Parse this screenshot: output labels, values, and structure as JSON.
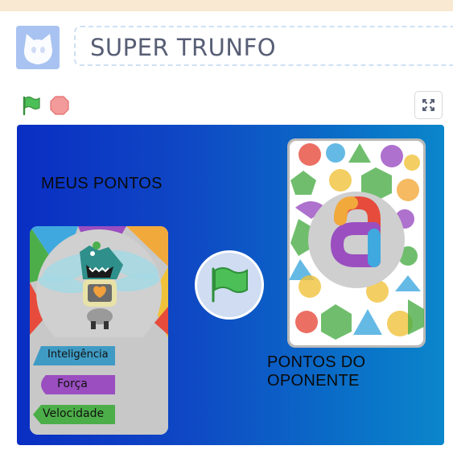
{
  "project": {
    "title": "SUPER TRUNFO"
  },
  "controls": {
    "green_flag_icon": "green-flag-icon",
    "stop_icon": "stop-icon",
    "fullscreen_icon": "fullscreen-icon"
  },
  "stage": {
    "my_points_label": "MEUS PONTOS",
    "opponent_points_label": "PONTOS DO OPONENTE",
    "my_card": {
      "stats": [
        {
          "label": "Inteligência",
          "color": "#3f9bc4"
        },
        {
          "label": "Força",
          "color": "#9a4ec0"
        },
        {
          "label": "Velocidade",
          "color": "#4cae48"
        }
      ]
    },
    "opponent_card": {
      "letter": "a"
    }
  },
  "colors": {
    "stage_left": "#0a2ec3",
    "stage_right": "#0b86cb",
    "title_text": "#575e75",
    "flag_green": "#4cbf56",
    "stop_red": "#f17a7a"
  }
}
